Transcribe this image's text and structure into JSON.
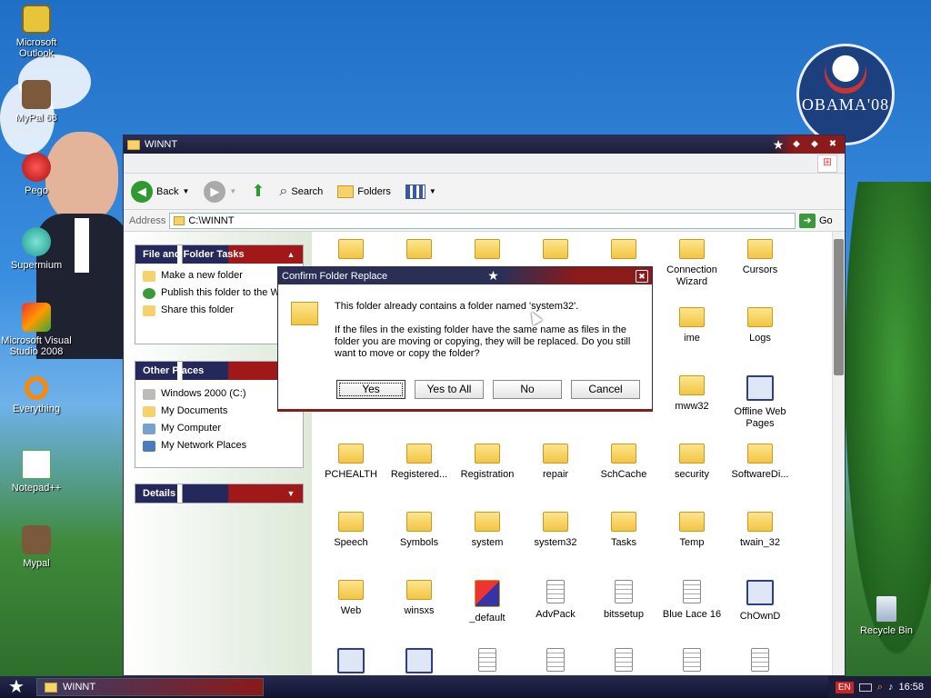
{
  "desktop": {
    "icons": [
      {
        "label": "Microsoft Outlook"
      },
      {
        "label": "MyPal 68"
      },
      {
        "label": "Pego"
      },
      {
        "label": "Supermium"
      },
      {
        "label": "Microsoft Visual Studio 2008"
      },
      {
        "label": "Everything"
      },
      {
        "label": "Notepad++"
      },
      {
        "label": "Mypal"
      }
    ],
    "logo_text": "OBAMA'08",
    "recycle_bin": "Recycle Bin"
  },
  "explorer": {
    "title": "WINNT",
    "toolbar": {
      "back": "Back",
      "search": "Search",
      "folders": "Folders"
    },
    "address_label": "Address",
    "address_value": "C:\\WINNT",
    "go": "Go",
    "panels": {
      "file_tasks": {
        "title": "File and Folder Tasks",
        "items": [
          "Make a new folder",
          "Publish this folder to the Web",
          "Share this folder"
        ]
      },
      "other_places": {
        "title": "Other Places",
        "items": [
          "Windows 2000 (C:)",
          "My Documents",
          "My Computer",
          "My Network Places"
        ]
      },
      "details": {
        "title": "Details"
      }
    },
    "files": [
      "",
      "",
      "",
      "",
      "",
      "Connection Wizard",
      "Cursors",
      "",
      "",
      "",
      "",
      "",
      "ime",
      "Logs",
      "",
      "",
      "",
      "",
      "",
      "mww32",
      "Offline Web Pages",
      "PCHEALTH",
      "Registered...",
      "Registration",
      "repair",
      "SchCache",
      "security",
      "SoftwareDi...",
      "Speech",
      "Symbols",
      "system",
      "system32",
      "Tasks",
      "Temp",
      "twain_32",
      "Web",
      "winsxs",
      "_default",
      "AdvPack",
      "bitssetup",
      "Blue Lace 16",
      "ChOwnD"
    ]
  },
  "dialog": {
    "title": "Confirm Folder Replace",
    "message": "This folder already contains a folder named 'system32'.",
    "detail": "If the files in the existing folder have the same name as files in the folder you are moving or copying, they will be replaced.  Do you still want to move or copy the folder?",
    "buttons": {
      "yes": "Yes",
      "yes_all": "Yes to All",
      "no": "No",
      "cancel": "Cancel"
    }
  },
  "taskbar": {
    "task": "WINNT",
    "lang": "EN",
    "clock": "16:58"
  }
}
